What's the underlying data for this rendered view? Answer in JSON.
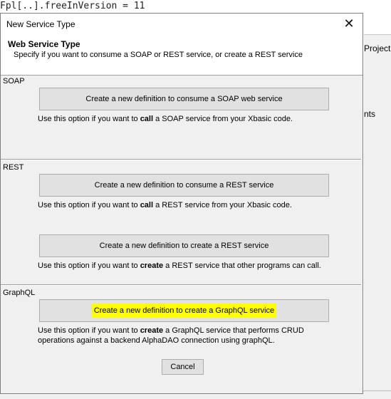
{
  "background": {
    "code_line": "Fpl[..].freeInVersion = 11",
    "right_text_1": "Project F",
    "right_text_2": "nts"
  },
  "dialog": {
    "title": "New Service Type",
    "close_glyph": "✕",
    "header_title": "Web Service Type",
    "header_subtitle": "Specify if you want to consume a SOAP or REST service, or create a REST service",
    "sections": {
      "soap": {
        "label": "SOAP",
        "button": "Create a new definition to consume a SOAP web service",
        "desc_pre": "Use this option if you want to ",
        "desc_bold": "call",
        "desc_post": " a SOAP service from your Xbasic code."
      },
      "rest": {
        "label": "REST",
        "consume_button": "Create a new definition to consume a REST service",
        "consume_desc_pre": "Use this option if you want to ",
        "consume_desc_bold": "call",
        "consume_desc_post": " a REST service from your Xbasic code.",
        "create_button": "Create a new definition to create a REST service",
        "create_desc_pre": "Use this option if you want to ",
        "create_desc_bold": "create",
        "create_desc_post": " a REST service that other programs can call."
      },
      "graphql": {
        "label": "GraphQL",
        "button": "Create a new definition to create a GraphQL service",
        "desc_pre": "Use this option if you want to ",
        "desc_bold": "create",
        "desc_post_line1": " a GraphQL service that performs CRUD",
        "desc_line2": "operations against a backend AlphaDAO connection using graphQL."
      }
    },
    "cancel_label": "Cancel",
    "highlight_color": "#ffff00"
  }
}
